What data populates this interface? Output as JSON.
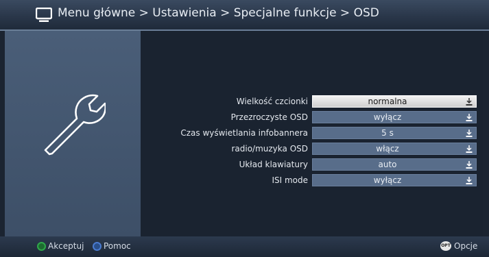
{
  "header": {
    "icon": "tv-icon",
    "breadcrumb": "Menu główne > Ustawienia > Specjalne funkcje > OSD"
  },
  "left_panel": {
    "icon": "wrench-icon"
  },
  "settings": [
    {
      "label": "Wielkość czcionki",
      "value": "normalna",
      "selected": true
    },
    {
      "label": "Przezroczyste OSD",
      "value": "wyłącz",
      "selected": false
    },
    {
      "label": "Czas wyświetlania infobannera",
      "value": "5 s",
      "selected": false
    },
    {
      "label": "radio/muzyka OSD",
      "value": "włącz",
      "selected": false
    },
    {
      "label": "Układ klawiatury",
      "value": "auto",
      "selected": false
    },
    {
      "label": "ISI mode",
      "value": "wyłącz",
      "selected": false
    }
  ],
  "footer": {
    "accept": {
      "label": "Akceptuj",
      "color": "#2fa84a"
    },
    "help": {
      "label": "Pomoc",
      "color": "#2f5fa8"
    },
    "options": {
      "label": "Opcje",
      "icon_text": "OPT"
    }
  },
  "colors": {
    "background": "#1b2431",
    "panel": "#4a5e78",
    "field": "#586d8a",
    "selected_field": "#f2f2f2"
  }
}
